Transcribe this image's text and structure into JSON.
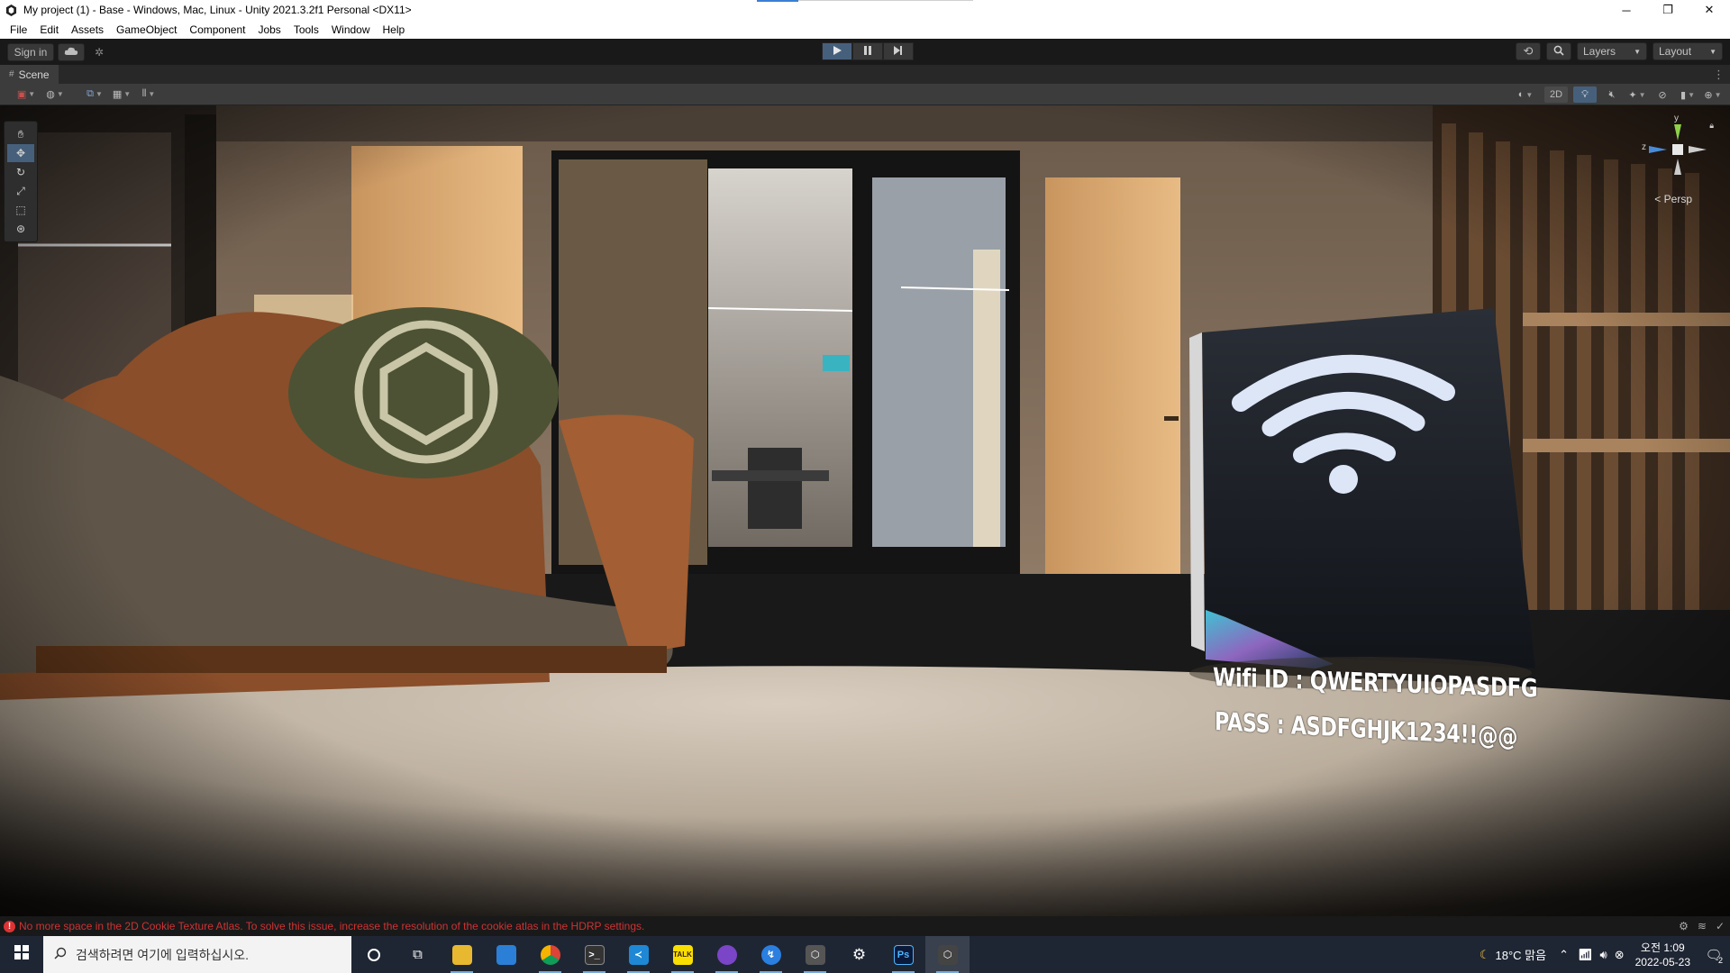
{
  "window": {
    "title": "My project (1) - Base - Windows, Mac, Linux - Unity 2021.3.2f1 Personal <DX11>",
    "minimize": "─",
    "restore": "❐",
    "close": "✕"
  },
  "menu": [
    "File",
    "Edit",
    "Assets",
    "GameObject",
    "Component",
    "Jobs",
    "Tools",
    "Window",
    "Help"
  ],
  "toolbar": {
    "sign_in": "Sign in",
    "layers": "Layers",
    "layout": "Layout"
  },
  "scene": {
    "tab_label": "Scene",
    "toggle_2d": "2D",
    "persp_label": "< Persp",
    "axis_y": "y",
    "axis_z": "z"
  },
  "sign": {
    "wifi_id": "Wifi ID : QWERTYUIOPASDFG",
    "pass": "PASS : ASDFGHJK1234!!@@"
  },
  "status": {
    "error_message": "No more space in the 2D Cookie Texture Atlas. To solve this issue, increase the resolution of the cookie atlas in the HDRP settings."
  },
  "taskbar": {
    "search_placeholder": "검색하려면 여기에 입력하십시오.",
    "weather": "18°C 맑음",
    "time": "오전 1:09",
    "date": "2022-05-23",
    "notification_count": "2",
    "ps_label": "Ps",
    "talk_label": "TALK"
  },
  "colors": {
    "accent": "#46607c",
    "error": "#cc3333",
    "taskbar": "#1f2633"
  }
}
